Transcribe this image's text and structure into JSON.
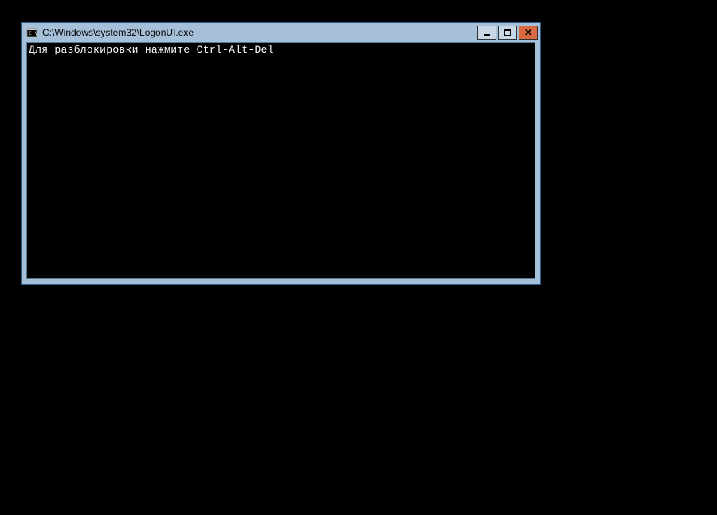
{
  "window": {
    "title": "C:\\Windows\\system32\\LogonUI.exe",
    "icon_name": "console-app-icon"
  },
  "titlebar_buttons": {
    "minimize_label": "Minimize",
    "maximize_label": "Maximize",
    "close_label": "Close"
  },
  "console": {
    "output": "Для разблокировки нажмите Ctrl-Alt-Del"
  },
  "colors": {
    "window_frame": "#a5c0d8",
    "close_button": "#d96a3f",
    "console_bg": "#000000",
    "console_fg": "#ffffff"
  }
}
